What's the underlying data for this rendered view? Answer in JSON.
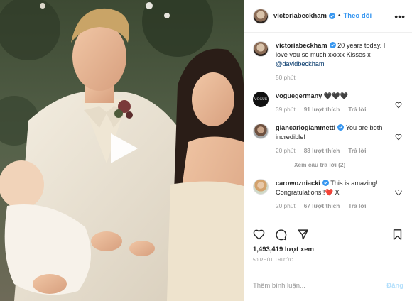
{
  "header": {
    "username": "victoriabeckham",
    "follow_label": "Theo dõi",
    "separator": "•",
    "more_label": "•••",
    "verified_icon": "verified-badge-icon"
  },
  "caption": {
    "username": "victoriabeckham",
    "text": " 20 years today. I love you so much xxxxx Kisses x ",
    "mention": "@davidbeckham",
    "time": "50 phút"
  },
  "comments": [
    {
      "username": "voguegermany",
      "avatar_text": "VOGUE",
      "text": " 🖤🖤🖤",
      "time": "39 phút",
      "likes": "91 lượt thích",
      "reply": "Trả lời"
    },
    {
      "username": "giancarlogiammetti",
      "text": " You are both incredible!",
      "time": "20 phút",
      "likes": "88 lượt thích",
      "reply": "Trả lời",
      "view_replies": "Xem câu trả lời (2)"
    },
    {
      "username": "carowozniacki",
      "text": " This is amazing! Congratulations!!",
      "emoji": "❤️",
      "text_end": " X",
      "time": "20 phút",
      "likes": "67 lượt thích",
      "reply": "Trả lời"
    }
  ],
  "actions": {
    "icons": [
      "heart-icon",
      "comment-icon",
      "share-icon",
      "bookmark-icon"
    ],
    "views": "1,493,419 lượt xem",
    "timestamp": "50 PHÚT TRƯỚC"
  },
  "add_comment": {
    "placeholder": "Thêm bình luận...",
    "post_label": "Đăng"
  },
  "colors": {
    "link_blue": "#3897f0",
    "post_disabled": "#b2dffc",
    "meta_gray": "#999999",
    "heart_red": "#ed4956"
  }
}
